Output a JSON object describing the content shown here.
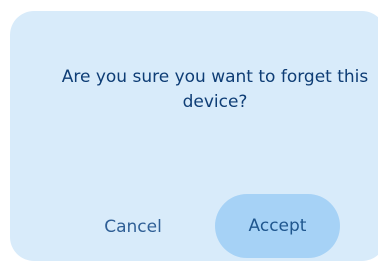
{
  "dialog": {
    "message": "Are you sure you want to forget this device?",
    "cancel_label": "Cancel",
    "accept_label": "Accept"
  },
  "colors": {
    "page_background": "#ffffff",
    "dialog_background": "#d8ebfa",
    "text": "#0e3d75",
    "accept_background": "#a6d2f6"
  }
}
